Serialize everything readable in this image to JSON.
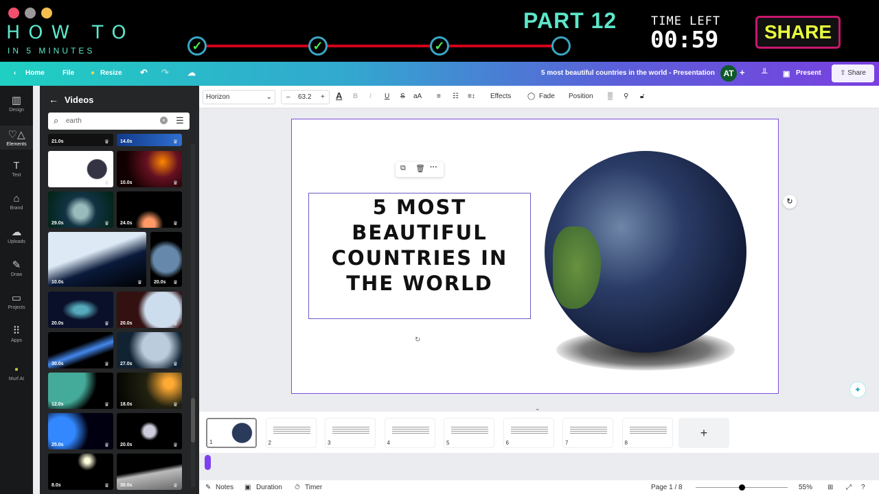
{
  "banner": {
    "title": "HOW TO",
    "subtitle": "IN 5 MINUTES",
    "part": "PART 12",
    "time_left_label": "TIME LEFT",
    "time_left": "00:59",
    "share": "SHARE",
    "steps_completed": 3,
    "steps_total": 4
  },
  "header": {
    "home": "Home",
    "file": "File",
    "resize": "Resize",
    "doc_title": "5 most beautiful countries in the world - Presentation",
    "avatar": "AT",
    "present": "Present",
    "share": "Share"
  },
  "rail": [
    {
      "label": "Design",
      "icon": "layout-icon"
    },
    {
      "label": "Elements",
      "icon": "shapes-icon"
    },
    {
      "label": "Text",
      "icon": "text-icon"
    },
    {
      "label": "Brand",
      "icon": "brand-icon"
    },
    {
      "label": "Uploads",
      "icon": "upload-icon"
    },
    {
      "label": "Draw",
      "icon": "draw-icon"
    },
    {
      "label": "Projects",
      "icon": "folder-icon"
    },
    {
      "label": "Apps",
      "icon": "apps-icon"
    },
    {
      "label": "Murf AI",
      "icon": "murf-icon"
    }
  ],
  "panel": {
    "title": "Videos",
    "search_value": "earth",
    "videos": [
      "21.0s",
      "14.0s",
      "28.0s",
      "10.0s",
      "29.0s",
      "24.0s",
      "10.0s",
      "20.0s",
      "20.0s",
      "20.0s",
      "30.0s",
      "27.0s",
      "12.0s",
      "18.0s",
      "25.0s",
      "20.0s",
      "8.0s",
      "30.0s"
    ]
  },
  "toolbar": {
    "font": "Horizon",
    "font_size": "63.2",
    "effects": "Effects",
    "fade": "Fade",
    "position": "Position"
  },
  "slide": {
    "title": "5 MOST BEAUTIFUL COUNTRIES IN THE WORLD"
  },
  "thumbnails": [
    "1",
    "2",
    "3",
    "4",
    "5",
    "6",
    "7",
    "8"
  ],
  "footer": {
    "notes": "Notes",
    "duration": "Duration",
    "timer": "Timer",
    "page": "Page 1 / 8",
    "zoom": "55%",
    "zoom_value": 55
  }
}
